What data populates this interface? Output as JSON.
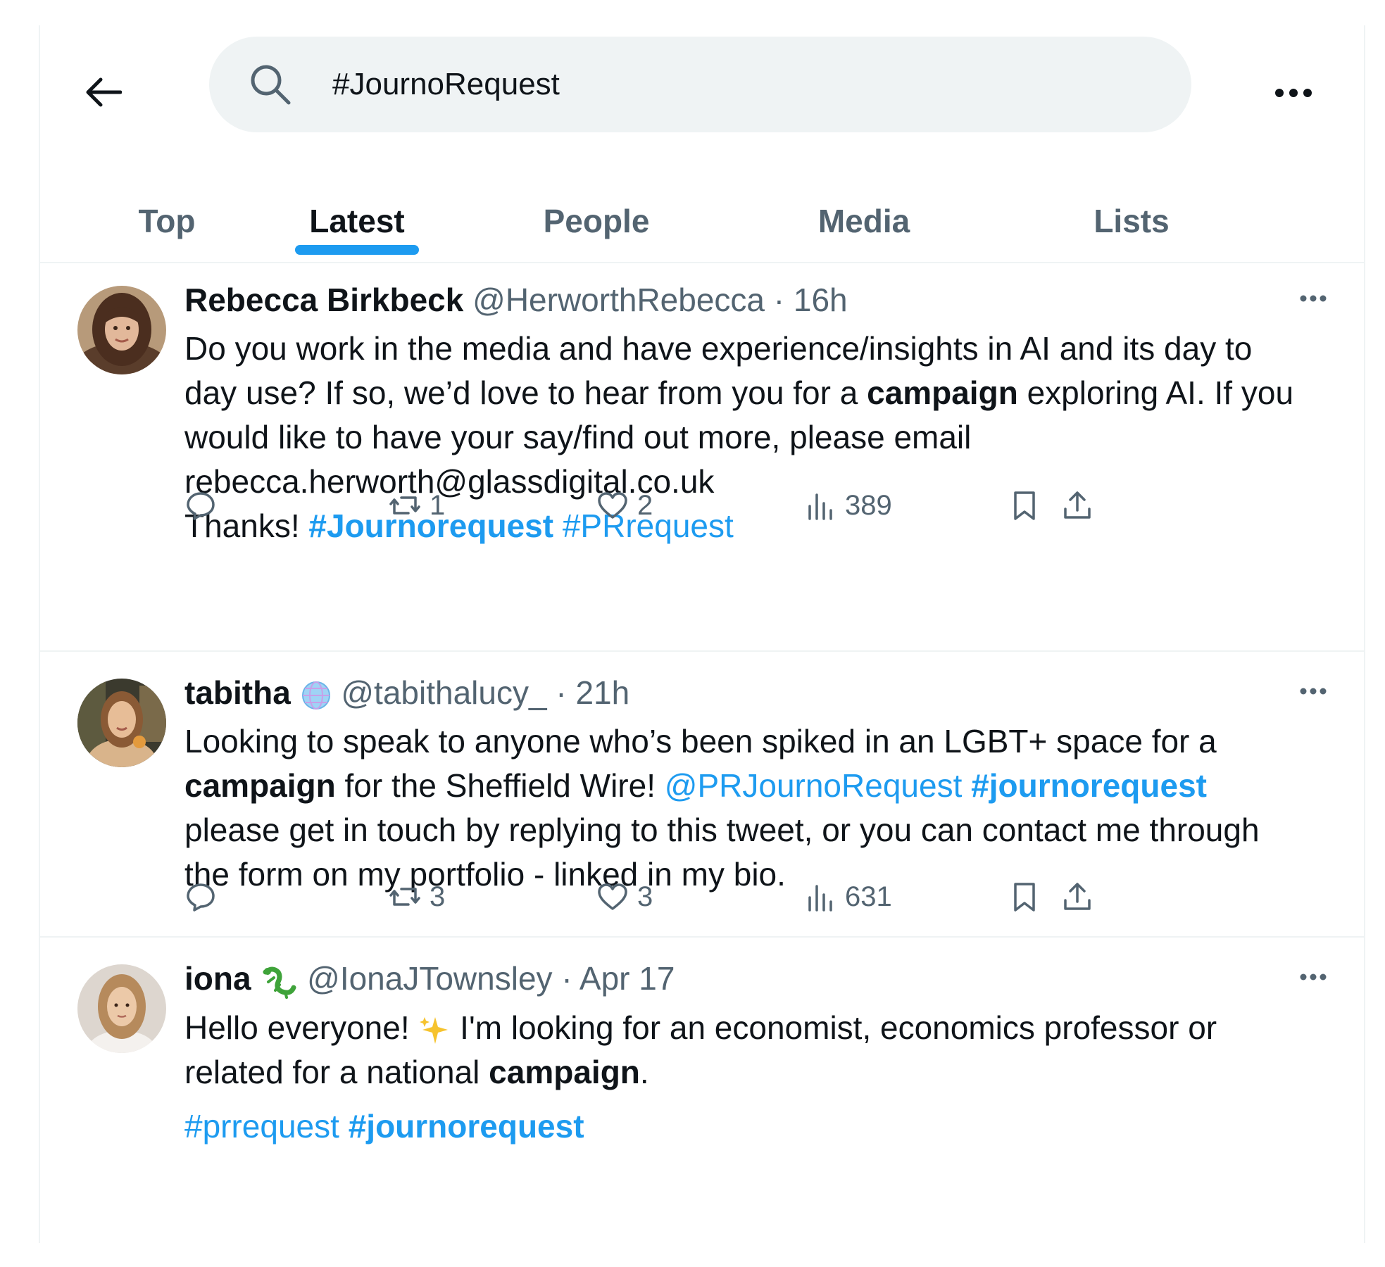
{
  "search": {
    "query": "#JournoRequest"
  },
  "tabs": [
    {
      "label": "Top"
    },
    {
      "label": "Latest"
    },
    {
      "label": "People"
    },
    {
      "label": "Media"
    },
    {
      "label": "Lists"
    }
  ],
  "active_tab": "Latest",
  "colors": {
    "accent": "#1d9bf0",
    "text": "#0f1419",
    "secondary": "#536471",
    "search_bg": "#eff3f4"
  },
  "tweets": [
    {
      "name": "Rebecca Birkbeck",
      "handle": "@HerworthRebecca",
      "sep": " · ",
      "time": "16h",
      "lines": [
        [
          {
            "t": "Do you work in the media and have experience/insights in AI and its day to"
          }
        ],
        [
          {
            "t": "day use? If so, we’d love to hear from you for a "
          },
          {
            "t": "campaign",
            "s": "bold"
          },
          {
            "t": " exploring AI. If you"
          }
        ],
        [
          {
            "t": "would like to have your say/find out more, please email"
          }
        ],
        [
          {
            "t": "rebecca.herworth@glassdigital.co.uk"
          }
        ],
        [
          {
            "t": "Thanks! "
          },
          {
            "t": "#Journorequest",
            "s": "tagbold"
          },
          {
            "t": " "
          },
          {
            "t": "#PRrequest",
            "s": "tag"
          }
        ]
      ],
      "stats": {
        "replies": "",
        "retweets": "1",
        "likes": "2",
        "views": "389"
      }
    },
    {
      "name": "tabitha",
      "name_icon": "globe-emoji",
      "handle": "@tabithalucy_",
      "sep": " · ",
      "time": "21h",
      "lines": [
        [
          {
            "t": "Looking to speak to anyone who’s been spiked in an LGBT+ space for a"
          }
        ],
        [
          {
            "t": "campaign",
            "s": "bold"
          },
          {
            "t": " for the Sheffield Wire! "
          },
          {
            "t": "@PRJournoRequest",
            "s": "tag"
          },
          {
            "t": " "
          },
          {
            "t": "#journorequest",
            "s": "tagbold"
          }
        ],
        [
          {
            "t": "please get in touch by replying to this tweet, or you can contact me through"
          }
        ],
        [
          {
            "t": "the form on my portfolio - linked in my bio."
          }
        ]
      ],
      "stats": {
        "replies": "",
        "retweets": "3",
        "likes": "3",
        "views": "631"
      }
    },
    {
      "name": "iona",
      "name_icon": "lizard-emoji",
      "handle": "@IonaJTownsley",
      "sep": " · ",
      "time": "Apr 17",
      "lines": [
        [
          {
            "t": "Hello everyone! "
          },
          {
            "e": "sparkles-emoji"
          },
          {
            "t": " I'm looking for an economist, economics professor or"
          }
        ],
        [
          {
            "t": "related for a national "
          },
          {
            "t": "campaign",
            "s": "bold"
          },
          {
            "t": "."
          }
        ],
        [
          {
            "t": "#prrequest",
            "s": "tag"
          },
          {
            "t": " "
          },
          {
            "t": "#journorequest",
            "s": "tagbold"
          }
        ]
      ]
    }
  ]
}
